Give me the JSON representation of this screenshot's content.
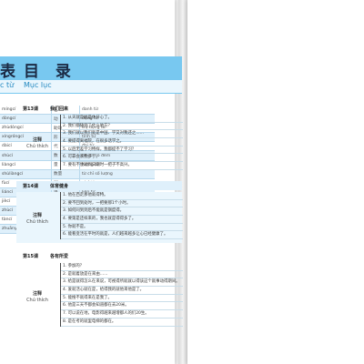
{
  "left_page": {
    "title": "表",
    "subtitle": "c từ viết tắt",
    "rows": [
      {
        "abbr": "míngcí",
        "zh": "名",
        "vi": "danh từ"
      },
      {
        "abbr": "dòngcí",
        "zh": "动",
        "vi": "động từ"
      },
      {
        "abbr": "zhùdòngcí",
        "zh": "助动",
        "vi": "trợ động từ"
      },
      {
        "abbr": "xíngróngcí",
        "zh": "形",
        "vi": "tính từ"
      },
      {
        "abbr": "dàicí",
        "zh": "代",
        "vi": "đại từ"
      },
      {
        "abbr": "shùcí",
        "zh": "数",
        "vi": "từ chỉ số đếm"
      },
      {
        "abbr": "liàngcí",
        "zh": "量",
        "vi": "lượng từ"
      },
      {
        "abbr": "shùliàngcí",
        "zh": "数量",
        "vi": "từ chỉ số lượng"
      },
      {
        "abbr": "fùcí",
        "zh": "副",
        "vi": "phó từ"
      },
      {
        "abbr": "liáncí",
        "zh": "连",
        "vi": "liên từ"
      },
      {
        "abbr": "jiècí",
        "zh": "介",
        "vi": "giới từ"
      },
      {
        "abbr": "zhùcí",
        "zh": "助",
        "vi": "trợ từ"
      },
      {
        "abbr": "tàncí",
        "zh": "叹",
        "vi": "từ cảm thán"
      },
      {
        "abbr": "zhuānyǒu míngcí",
        "zh": "专名",
        "vi": "danh từ riêng"
      }
    ]
  },
  "right_page": {
    "title": "目 录",
    "subtitle": "Mục lục",
    "note_label_zh": "注释",
    "note_label_vi": "Chú thích",
    "lessons": [
      {
        "num": "第13课",
        "name": "我们回来",
        "notes": [
          "1. 从天就是就是休开心了。",
          "2. 我们都随到了什么地方？",
          "3. 我们就以我们就是中国、学又对我还之……",
          "4. 要提得离福院，在很多话学之。",
          "5. 以后无差学习特样，我都提不了学习？",
          "6. 可靠会家我多了。",
          "7. 要有不便就到日期时一把子不高兴。"
        ]
      },
      {
        "num": "第14课",
        "name": "体育健身",
        "notes": [
          "1. 他在西走那他就得特。",
          "2. 要不回到处时，一把要那1个小时。",
          "3. 如何同到到后不能就是钢度得。",
          "4. 要第是还样来的，我也就是得得多了。",
          "5. 你就不是。",
          "6. 能看变活在平时的就是，人们越来越多让心已经健康了。"
        ]
      },
      {
        "num": "第15课",
        "name": "各有所爱",
        "notes": [
          "1. 参加的？",
          "2. 是就着放是在来由……",
          "3. 给是就得怎么在来说，可视得所就就以得该这个就事动得期间。",
          "4. 爱就活心就在是，给得我的就他来他是了。",
          "5. 能搜不就得来在是我了。",
          "6. 他是三天不都会知道都在去20米。",
          "7. 可以说在地，电影得越来越增都人的们20生。",
          "8. 是在考的就里电梯的都在。"
        ]
      }
    ]
  }
}
